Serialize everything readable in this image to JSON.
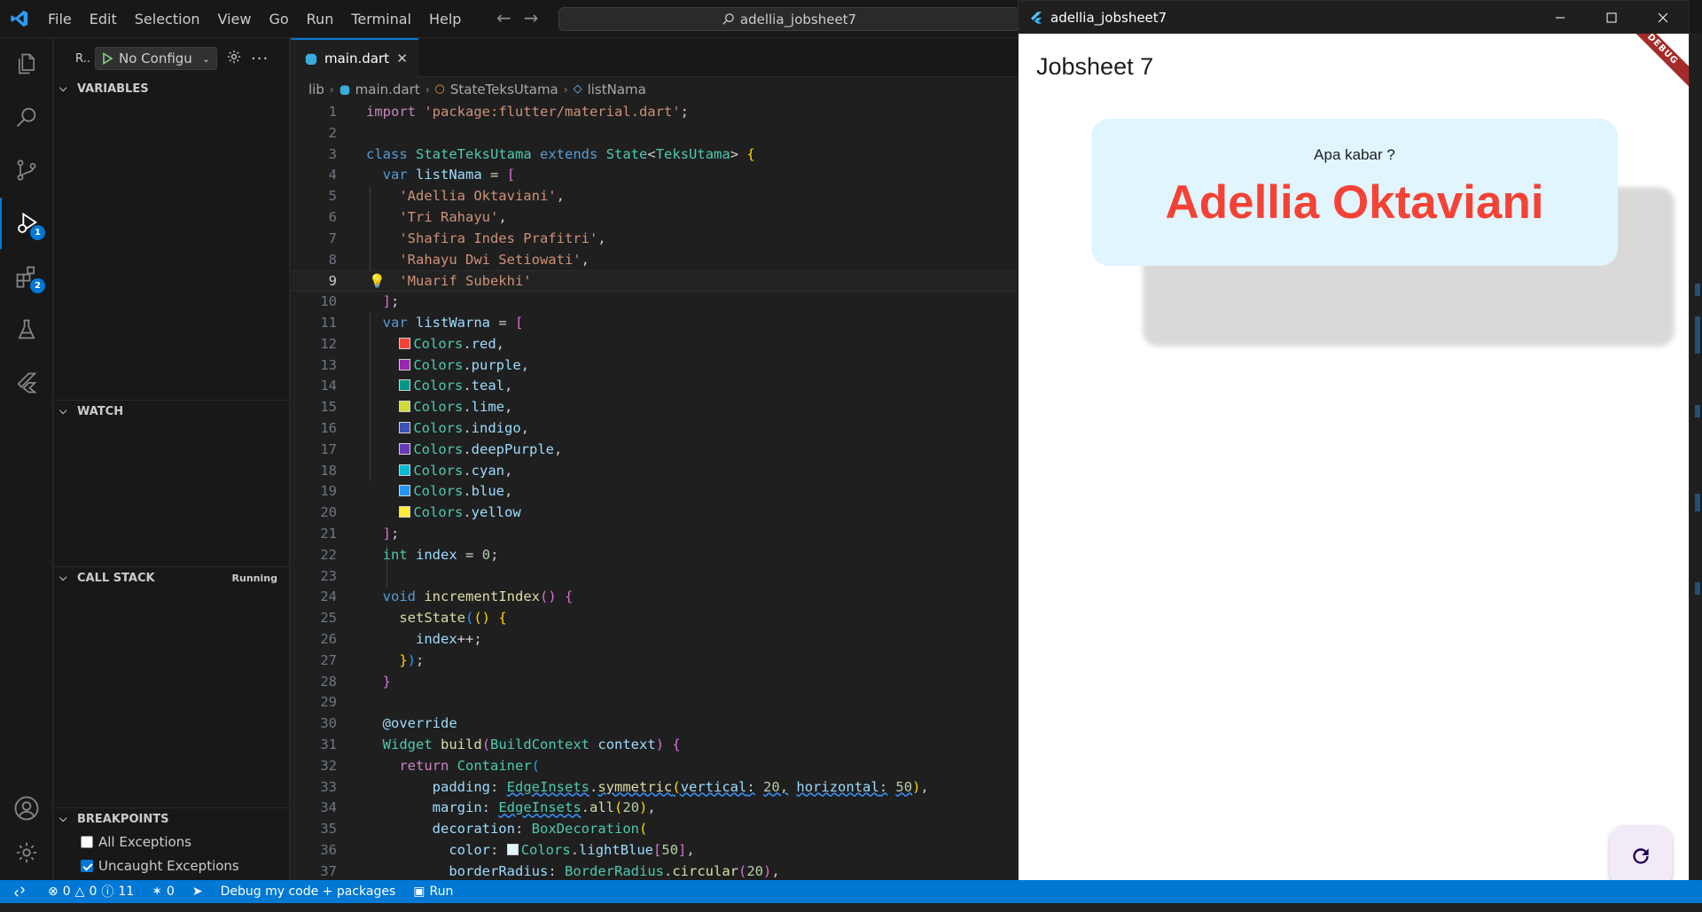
{
  "titlebar": {
    "menu": [
      "File",
      "Edit",
      "Selection",
      "View",
      "Go",
      "Run",
      "Terminal",
      "Help"
    ],
    "search_text": "adellia_jobsheet7"
  },
  "activity": {
    "debug_badge": "1",
    "extensions_badge": "2"
  },
  "sidebar": {
    "run_title": "R..",
    "config": "No Configu",
    "sections": {
      "variables": "VARIABLES",
      "watch": "WATCH",
      "callstack": "CALL STACK",
      "callstack_status": "Running",
      "breakpoints": "BREAKPOINTS"
    },
    "breakpoints": [
      {
        "label": "All Exceptions",
        "checked": false
      },
      {
        "label": "Uncaught Exceptions",
        "checked": true
      }
    ]
  },
  "editor": {
    "tab": "main.dart",
    "breadcrumb": [
      "lib",
      "main.dart",
      "StateTeksUtama",
      "listNama"
    ],
    "current_line": 9
  },
  "statusbar": {
    "errors": "0",
    "warnings": "0",
    "info": "11",
    "ports": "0",
    "debug_label": "Debug my code + packages",
    "run_label": "Run"
  },
  "app": {
    "window_title": "adellia_jobsheet7",
    "appbar_title": "Jobsheet 7",
    "debug_banner": "DEBUG",
    "card_subtitle": "Apa kabar ?",
    "card_name": "Adellia Oktaviani",
    "card_name_color": "#f44336",
    "card_bg_color": "#e1f5fe"
  },
  "colors": {
    "accent": "#0078d4",
    "swatches": {
      "red": "#f44336",
      "purple": "#9c27b0",
      "teal": "#009688",
      "lime": "#cddc39",
      "indigo": "#3f51b5",
      "deepPurple": "#673ab7",
      "cyan": "#00bcd4",
      "blue": "#2196f3",
      "yellow": "#ffeb3b",
      "lightBlue50": "#e1f5fe"
    }
  }
}
